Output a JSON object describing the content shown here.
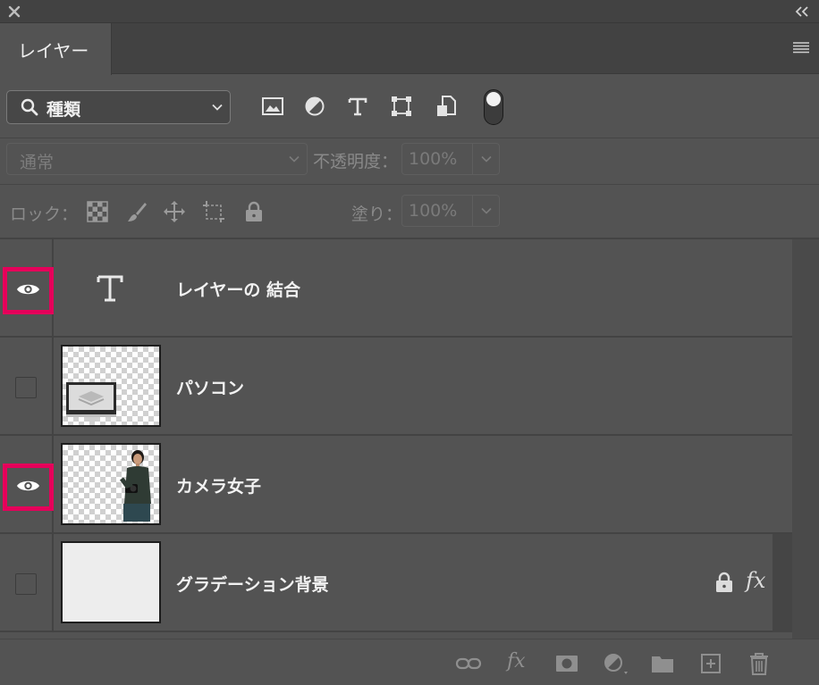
{
  "panel": {
    "tab_label": "レイヤー",
    "close_icon": "close-icon",
    "collapse_icon": "collapse-double-chevron-icon",
    "menu_icon": "panel-menu-icon"
  },
  "filter": {
    "kind_label": "種類",
    "filter_icons": [
      "image-filter-icon",
      "adjustment-filter-icon",
      "type-filter-icon",
      "shape-filter-icon",
      "smart-object-filter-icon"
    ],
    "toggle_on": true
  },
  "blend": {
    "mode": "通常",
    "opacity_label": "不透明度：",
    "opacity_value": "100%"
  },
  "lock": {
    "label": "ロック：",
    "icons": [
      "lock-transparent-icon",
      "lock-paint-icon",
      "lock-position-icon",
      "lock-artboard-icon",
      "lock-all-icon"
    ],
    "fill_label": "塗り：",
    "fill_value": "100%"
  },
  "layers": [
    {
      "name": "レイヤーの 結合",
      "visible": true,
      "highlighted": true,
      "thumb": "type-layer"
    },
    {
      "name": "パソコン",
      "visible": false,
      "highlighted": false,
      "thumb": "computer-image"
    },
    {
      "name": "カメラ女子",
      "visible": true,
      "highlighted": true,
      "thumb": "woman-with-camera-image"
    },
    {
      "name": "グラデーション背景",
      "visible": false,
      "highlighted": false,
      "thumb": "gradient-fill",
      "locked": true,
      "fx": "fx"
    }
  ],
  "bottom_bar": {
    "icons": [
      "link-layers-icon",
      "add-style-icon",
      "add-mask-icon",
      "new-adjustment-icon",
      "new-group-icon",
      "new-layer-icon",
      "delete-layer-icon"
    ],
    "fx_label": "fx"
  },
  "colors": {
    "highlight": "#e5005a",
    "panel_bg": "#535353",
    "header_bg": "#424242"
  }
}
